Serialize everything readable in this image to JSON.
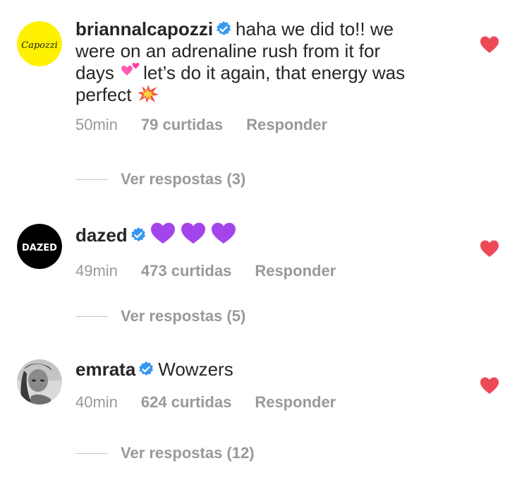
{
  "colors": {
    "text": "#262626",
    "secondary": "#999999",
    "verified": "#3897f0",
    "heart": "#ed4956"
  },
  "comments": [
    {
      "avatar": {
        "type": "logo",
        "text": "Capozzi",
        "background": "#fef200"
      },
      "username": "briannalcapozzi",
      "verified": true,
      "text_line1": "haha we did to!! we",
      "text_line2": "were on an adrenaline rush from it for",
      "text_line3a": "days",
      "emoji1": "two-hearts-emoji",
      "text_line3b": "let’s do it again, that energy was",
      "text_line4": "perfect",
      "emoji2": "collision-emoji",
      "time": "50min",
      "likes": "79 curtidas",
      "reply": "Responder",
      "view_replies": "Ver respostas (3)",
      "liked": true
    },
    {
      "avatar": {
        "type": "logo",
        "text": "DAZED",
        "background": "#000000"
      },
      "username": "dazed",
      "verified": true,
      "emojis": [
        "purple-heart-emoji",
        "purple-heart-emoji",
        "purple-heart-emoji"
      ],
      "time": "49min",
      "likes": "473 curtidas",
      "reply": "Responder",
      "view_replies": "Ver respostas (5)",
      "liked": true
    },
    {
      "avatar": {
        "type": "photo"
      },
      "username": "emrata",
      "verified": true,
      "text": "Wowzers",
      "time": "40min",
      "likes": "624 curtidas",
      "reply": "Responder",
      "view_replies": "Ver respostas (12)",
      "liked": true
    }
  ]
}
